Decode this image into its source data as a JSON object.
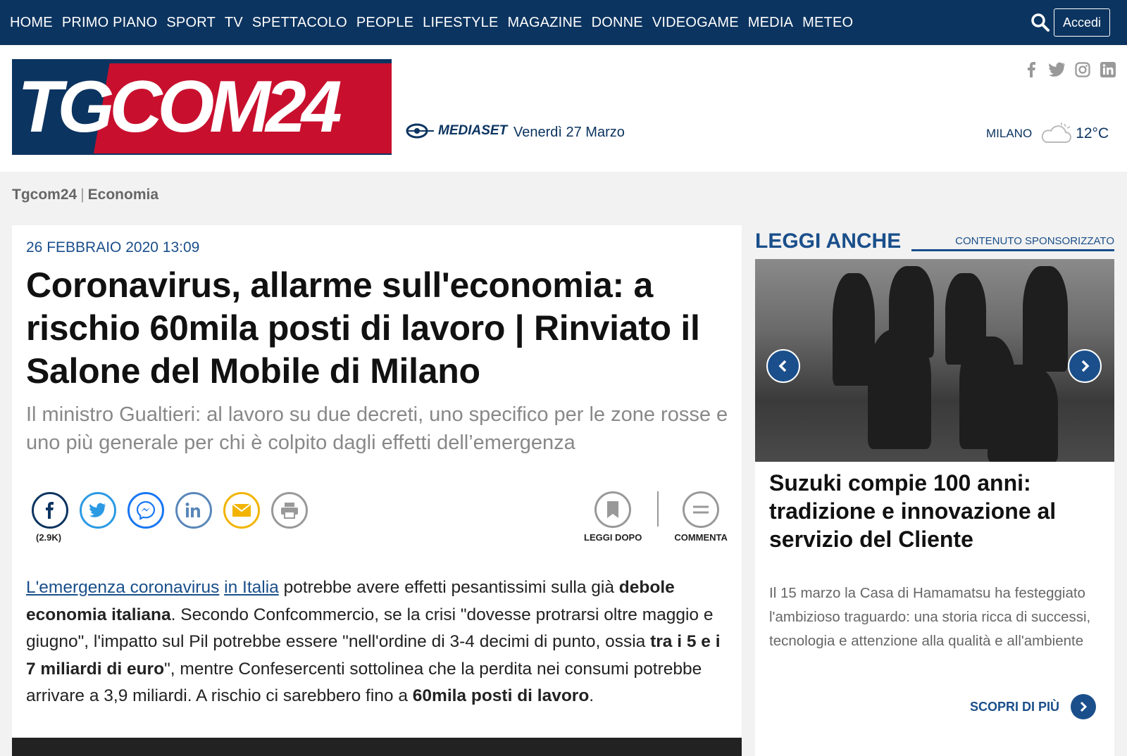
{
  "nav": {
    "items": [
      "HOME",
      "PRIMO PIANO",
      "SPORT",
      "TV",
      "SPETTACOLO",
      "PEOPLE",
      "LIFESTYLE",
      "MAGAZINE",
      "DONNE",
      "VIDEOGAME",
      "MEDIA",
      "METEO"
    ],
    "login_label": "Accedi",
    "search_icon": "search-icon"
  },
  "header": {
    "logo_text": "TGCOM24",
    "partner": "MEDIASET",
    "date": "Venerdì 27 Marzo",
    "social_icons": [
      "facebook-icon",
      "twitter-icon",
      "instagram-icon",
      "linkedin-icon"
    ],
    "weather": {
      "city": "MILANO",
      "temp": "12°C",
      "icon": "cloud-icon"
    }
  },
  "breadcrumb": {
    "home": "Tgcom24",
    "section": "Economia"
  },
  "article": {
    "date": "26 FEBBRAIO 2020 13:09",
    "title": "Coronavirus, allarme sull'economia: a rischio 60mila posti di lavoro | Rinviato il Salone del Mobile di Milano",
    "subtitle": "Il ministro Gualtieri: al lavoro su due decreti, uno specifico per le zone rosse e uno più generale per chi è colpito dagli effetti dell’emergenza",
    "share_count": "(2.9K)",
    "read_later_label": "LEGGI DOPO",
    "comment_label": "COMMENTA",
    "body": {
      "link1": "L'emergenza coronavirus",
      "link2": "in Italia",
      "t1": " potrebbe avere effetti pesantissimi sulla già ",
      "b1": "debole economia italiana",
      "t2": ". Secondo Confcommercio, se la crisi \"dovesse protrarsi oltre maggio e giugno\", l'impatto sul Pil potrebbe essere \"nell'ordine di 3-4 decimi di punto, ossia ",
      "b2": "tra i 5 e i 7 miliardi di euro",
      "t3": "\", mentre Confesercenti sottolinea che la perdita nei consumi potrebbe arrivare a 3,9 miliardi. A rischio ci sarebbero fino a ",
      "b3": "60mila posti di lavoro",
      "t4": "."
    }
  },
  "sidebar": {
    "title": "LEGGI ANCHE",
    "sponsor_label": "CONTENUTO SPONSORIZZATO",
    "promo_title": "Suzuki compie 100 anni: tradizione e innovazione al servizio del Cliente",
    "promo_desc": "Il 15 marzo la Casa di Hamamatsu ha festeggiato l'ambizioso traguardo: una storia ricca di successi, tecnologia e attenzione alla qualità e all'ambiente",
    "cta_label": "SCOPRI DI PIÙ"
  },
  "colors": {
    "navy": "#0c3460",
    "accent_blue": "#1a4f8b",
    "brand_red": "#c8102e"
  }
}
